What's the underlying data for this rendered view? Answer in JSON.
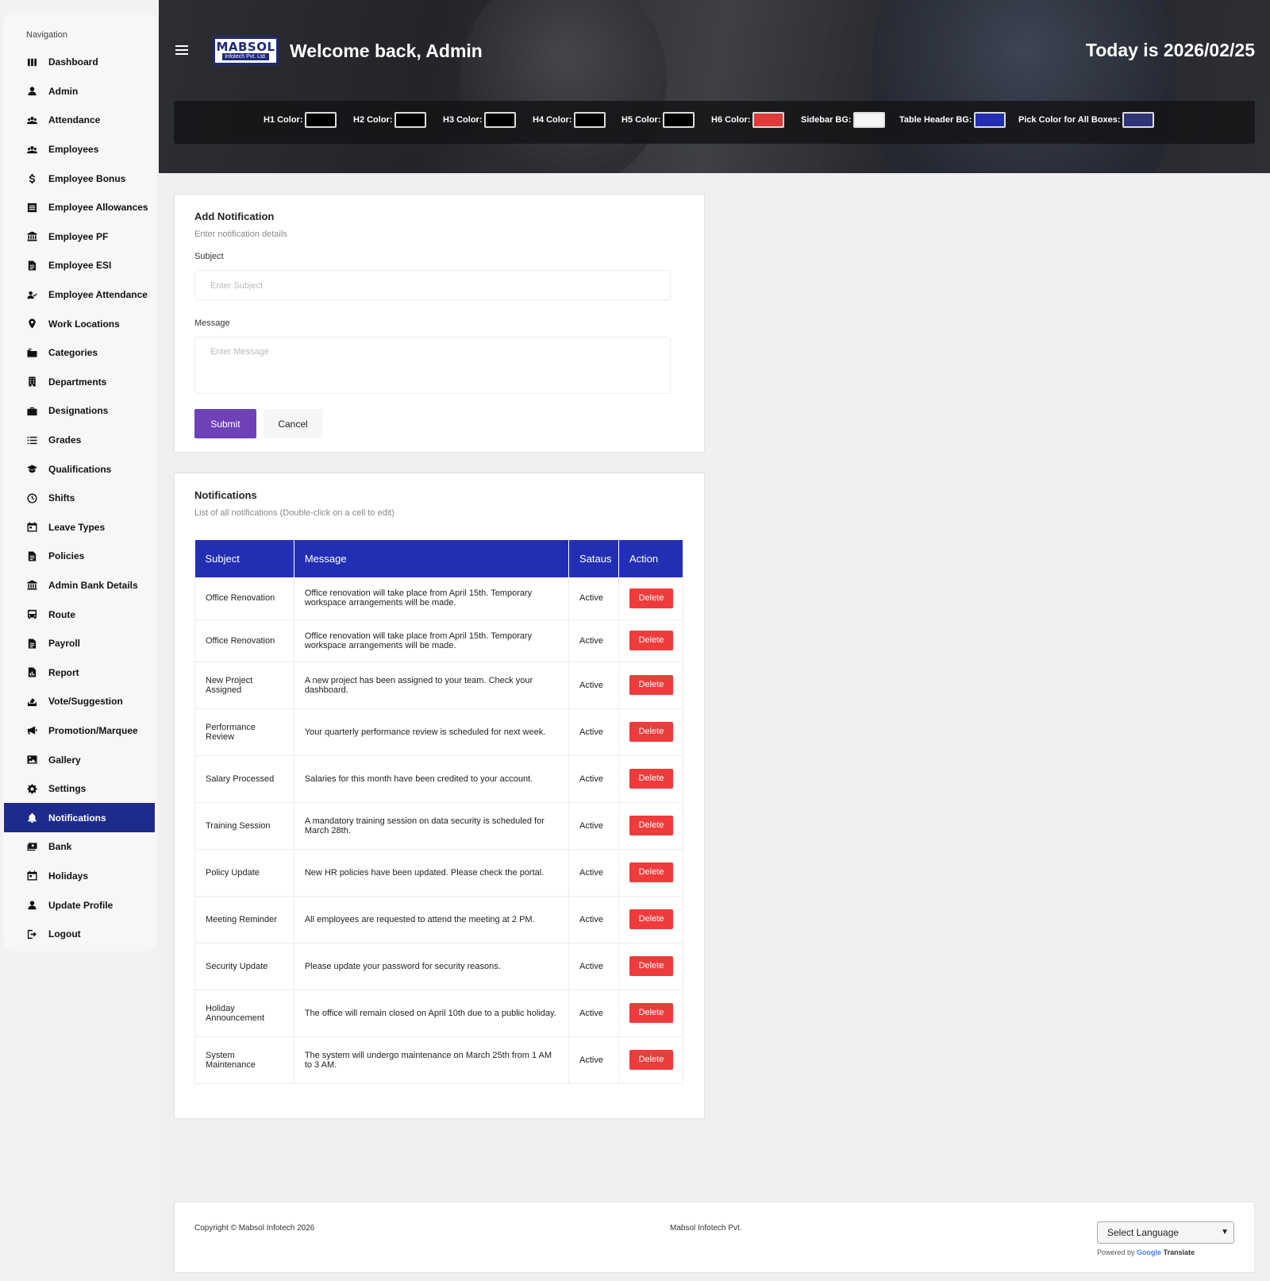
{
  "sidebar": {
    "heading": "Navigation",
    "items": [
      {
        "label": "Dashboard",
        "icon": "dashboard-icon"
      },
      {
        "label": "Admin",
        "icon": "user-icon"
      },
      {
        "label": "Attendance",
        "icon": "users-icon"
      },
      {
        "label": "Employees",
        "icon": "users-icon"
      },
      {
        "label": "Employee Bonus",
        "icon": "dollar-icon"
      },
      {
        "label": "Employee Allowances",
        "icon": "list-box-icon"
      },
      {
        "label": "Employee PF",
        "icon": "bank-icon"
      },
      {
        "label": "Employee ESI",
        "icon": "document-icon"
      },
      {
        "label": "Employee Attendance",
        "icon": "user-check-icon"
      },
      {
        "label": "Work Locations",
        "icon": "location-pin-icon"
      },
      {
        "label": "Categories",
        "icon": "folders-icon"
      },
      {
        "label": "Departments",
        "icon": "building-icon"
      },
      {
        "label": "Designations",
        "icon": "briefcase-icon"
      },
      {
        "label": "Grades",
        "icon": "list-icon"
      },
      {
        "label": "Qualifications",
        "icon": "graduation-cap-icon"
      },
      {
        "label": "Shifts",
        "icon": "clock-icon"
      },
      {
        "label": "Leave Types",
        "icon": "calendar-icon"
      },
      {
        "label": "Policies",
        "icon": "document-icon"
      },
      {
        "label": "Admin Bank Details",
        "icon": "bank-icon"
      },
      {
        "label": "Route",
        "icon": "bus-icon"
      },
      {
        "label": "Payroll",
        "icon": "document-icon"
      },
      {
        "label": "Report",
        "icon": "report-icon"
      },
      {
        "label": "Vote/Suggestion",
        "icon": "vote-icon"
      },
      {
        "label": "Promotion/Marquee",
        "icon": "megaphone-icon"
      },
      {
        "label": "Gallery",
        "icon": "image-icon"
      },
      {
        "label": "Settings",
        "icon": "gear-icon"
      },
      {
        "label": "Notifications",
        "icon": "bell-icon",
        "active": true
      },
      {
        "label": "Bank",
        "icon": "cash-icon"
      },
      {
        "label": "Holidays",
        "icon": "calendar-icon"
      },
      {
        "label": "Update Profile",
        "icon": "user-icon"
      },
      {
        "label": "Logout",
        "icon": "logout-icon"
      }
    ]
  },
  "header": {
    "logo_top": "MABSOL",
    "logo_bottom": "Infotech Pvt. Ltd.",
    "welcome": "Welcome back, Admin",
    "today": "Today is 2026/02/25",
    "color_pickers": [
      {
        "label": "H1 Color:",
        "color": "#000000"
      },
      {
        "label": "H2 Color:",
        "color": "#000000"
      },
      {
        "label": "H3 Color:",
        "color": "#000000"
      },
      {
        "label": "H4 Color:",
        "color": "#000000"
      },
      {
        "label": "H5 Color:",
        "color": "#000000"
      },
      {
        "label": "H6 Color:",
        "color": "#e03a3a"
      },
      {
        "label": "Sidebar BG:",
        "color": "#f5f5f5"
      },
      {
        "label": "Table Header BG:",
        "color": "#222fb4"
      },
      {
        "label": "Pick Color for All Boxes:",
        "color": "#2d3577"
      }
    ]
  },
  "add_form": {
    "title": "Add Notification",
    "subtitle": "Enter notification details",
    "subject_label": "Subject",
    "subject_placeholder": "Enter Subject",
    "message_label": "Message",
    "message_placeholder": "Enter Message",
    "submit": "Submit",
    "cancel": "Cancel"
  },
  "notifications": {
    "title": "Notifications",
    "subtitle": "List of all notifications (Double-click on a cell to edit)",
    "columns": [
      "Subject",
      "Message",
      "Sataus",
      "Action"
    ],
    "delete_label": "Delete",
    "rows": [
      {
        "subject": "Office Renovation",
        "message": "Office renovation will take place from April 15th. Temporary workspace arrangements will be made.",
        "status": "Active"
      },
      {
        "subject": "Office Renovation",
        "message": "Office renovation will take place from April 15th. Temporary workspace arrangements will be made.",
        "status": "Active"
      },
      {
        "subject": "New Project Assigned",
        "message": "A new project has been assigned to your team. Check your dashboard.",
        "status": "Active"
      },
      {
        "subject": "Performance Review",
        "message": "Your quarterly performance review is scheduled for next week.",
        "status": "Active"
      },
      {
        "subject": "Salary Processed",
        "message": "Salaries for this month have been credited to your account.",
        "status": "Active"
      },
      {
        "subject": "Training Session",
        "message": "A mandatory training session on data security is scheduled for March 28th.",
        "status": "Active"
      },
      {
        "subject": "Policy Update",
        "message": "New HR policies have been updated. Please check the portal.",
        "status": "Active"
      },
      {
        "subject": "Meeting Reminder",
        "message": "All employees are requested to attend the meeting at 2 PM.",
        "status": "Active"
      },
      {
        "subject": "Security Update",
        "message": "Please update your password for security reasons.",
        "status": "Active"
      },
      {
        "subject": "Holiday Announcement",
        "message": "The office will remain closed on April 10th due to a public holiday.",
        "status": "Active"
      },
      {
        "subject": "System Maintenance",
        "message": "The system will undergo maintenance on March 25th from 1 AM to 3 AM.",
        "status": "Active"
      }
    ]
  },
  "footer": {
    "copyright": "Copyright © Mabsol Infotech 2026",
    "company": "Mabsol Infotech Pvt.",
    "language_select": "Select Language",
    "powered_by": "Powered by",
    "google": "Google",
    "translate": "Translate"
  }
}
